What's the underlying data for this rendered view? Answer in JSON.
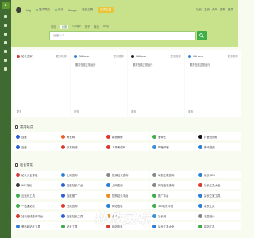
{
  "sidebar": {
    "logo": "a",
    "item_count": 7
  },
  "header": {
    "links": [
      "bbg",
      "站内导航",
      "关于",
      "Google",
      "站长工具",
      "站内工具"
    ],
    "active": "站内工具",
    "right": [
      "站长",
      "主页",
      "天气",
      "更新",
      "登录"
    ]
  },
  "search": {
    "tabs": [
      "常用",
      "百度",
      "Google",
      "知乎",
      "微信",
      "Bing"
    ],
    "active_tab": "百度",
    "placeholder": "百度一下"
  },
  "hot_cards": [
    {
      "title": "站长之家",
      "more": "更多推荐",
      "icon_color": "#d23b3b",
      "item": "",
      "foot_left": "更多",
      "foot_right": ""
    },
    {
      "title": "GitHome",
      "more": "更多推荐",
      "icon_color": "#2a7ed6",
      "item": "服务在线正常运行",
      "foot_left": "更多",
      "foot_right": ""
    },
    {
      "title": "GitHome",
      "more": "更多推荐",
      "icon_color": "#222222",
      "item": "服务在线正常运行",
      "foot_left": "更多",
      "foot_right": ""
    },
    {
      "title": "GitHome",
      "more": "更多推荐",
      "icon_color": "#2a7ed6",
      "item": "服务在线正常运行",
      "foot_left": "更多",
      "foot_right": ""
    }
  ],
  "sections": [
    {
      "title": "常用站点",
      "tiles": [
        {
          "label": "百度",
          "color": "#2a5fd6"
        },
        {
          "label": "淘宝网",
          "color": "#f25c1e"
        },
        {
          "label": "新浪微博",
          "color": "#e2322b"
        },
        {
          "label": "爱奇艺",
          "color": "#3fae49"
        },
        {
          "label": "抖音短视频",
          "color": "#111111"
        },
        {
          "label": "百度",
          "color": "#2a5fd6"
        },
        {
          "label": "京东商城",
          "color": "#d93a2b"
        },
        {
          "label": "人事考试网",
          "color": "#d93a2b"
        },
        {
          "label": "哔哩哔哩",
          "color": "#3a8fd6"
        },
        {
          "label": "腾讯视频",
          "color": "#2a7ed6"
        }
      ]
    },
    {
      "title": "站长常用",
      "tiles": [
        {
          "label": "站长大全导航",
          "color": "#d23b3b"
        },
        {
          "label": "上网查询",
          "color": "#2a7ed6"
        },
        {
          "label": "搜索站长查询",
          "color": "#888888"
        },
        {
          "label": "域名在线查询",
          "color": "#888888"
        },
        {
          "label": "站长SEO",
          "color": "#2a7ed6"
        },
        {
          "label": "WP 站长",
          "color": "#3a3a3a"
        },
        {
          "label": "百度站长平台",
          "color": "#2a5fd6"
        },
        {
          "label": "上网查询",
          "color": "#2a7ed6"
        },
        {
          "label": "网站信息查询",
          "color": "#888888"
        },
        {
          "label": "站长工具大全",
          "color": "#d93a2b"
        },
        {
          "label": "云站长工具",
          "color": "#3fae49"
        },
        {
          "label": "百度推广",
          "color": "#2a5fd6"
        },
        {
          "label": "搜狗站长平台",
          "color": "#f28a1e"
        },
        {
          "label": "推广平台",
          "color": "#3fae49"
        },
        {
          "label": "站长之家工具",
          "color": "#2a7ed6"
        },
        {
          "label": "一站通站长",
          "color": "#3fae49"
        },
        {
          "label": "在线查询",
          "color": "#e2322b"
        },
        {
          "label": "网站信息",
          "color": "#2a7ed6"
        },
        {
          "label": "360站长平台",
          "color": "#3fae49"
        },
        {
          "label": "站长工具",
          "color": "#2a7ed6"
        },
        {
          "label": "站长在线查询平台",
          "color": "#d93a2b"
        },
        {
          "label": "百度站长工具",
          "color": "#2a5fd6"
        },
        {
          "label": "免费统计",
          "color": "#f28a1e"
        },
        {
          "label": "站长网",
          "color": "#3a8fd6"
        },
        {
          "label": "流量统计",
          "color": "#888888"
        },
        {
          "label": "爱站网站长工具",
          "color": "#2a7ed6"
        },
        {
          "label": "站长工具",
          "color": "#3fae49"
        },
        {
          "label": "网站信息",
          "color": "#d93a2b"
        },
        {
          "label": "站长工具大全",
          "color": "#2a7ed6"
        },
        {
          "label": "建站工具",
          "color": "#3fae49"
        }
      ]
    }
  ],
  "watermark": "秒收录啦"
}
